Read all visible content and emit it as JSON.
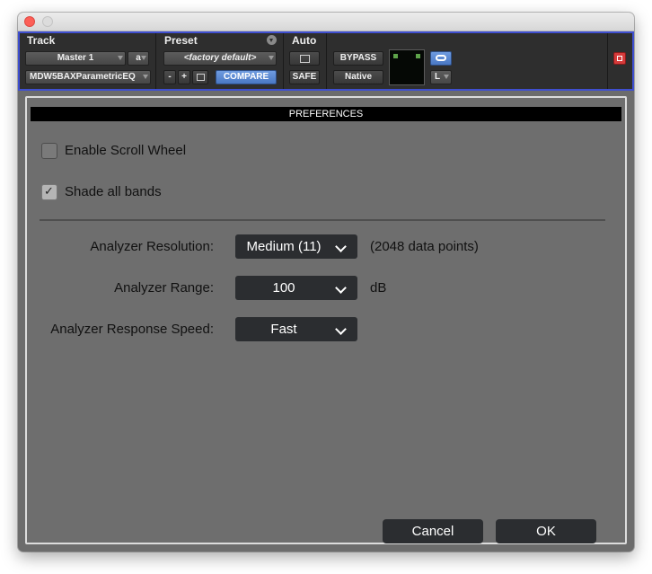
{
  "header": {
    "track": {
      "title": "Track",
      "track_name": "Master 1",
      "channel": "a",
      "plugin_name": "MDW5BAXParametricEQ"
    },
    "preset": {
      "title": "Preset",
      "preset_name": "<factory default>",
      "minus_label": "-",
      "plus_label": "+",
      "compare_label": "COMPARE"
    },
    "auto": {
      "title": "Auto",
      "safe_label": "SAFE"
    },
    "bypass_label": "BYPASS",
    "mode_label": "Native",
    "channel_select": "L",
    "colors": {
      "header_bg": "#2e2e2e",
      "border_blue": "#3f4fd0",
      "accent_blue": "#5b89d4",
      "close_red": "#d63b3b"
    }
  },
  "preferences": {
    "title": "PREFERENCES",
    "enable_scroll_wheel": {
      "label": "Enable Scroll Wheel",
      "checked": false
    },
    "shade_all_bands": {
      "label": "Shade all bands",
      "checked": true,
      "check_glyph": "✓"
    },
    "analyzer_resolution": {
      "label": "Analyzer Resolution:",
      "value": "Medium (11)",
      "note": "(2048 data points)"
    },
    "analyzer_range": {
      "label": "Analyzer Range:",
      "value": "100",
      "unit": "dB"
    },
    "analyzer_response_speed": {
      "label": "Analyzer Response Speed:",
      "value": "Fast"
    },
    "cancel_label": "Cancel",
    "ok_label": "OK"
  }
}
